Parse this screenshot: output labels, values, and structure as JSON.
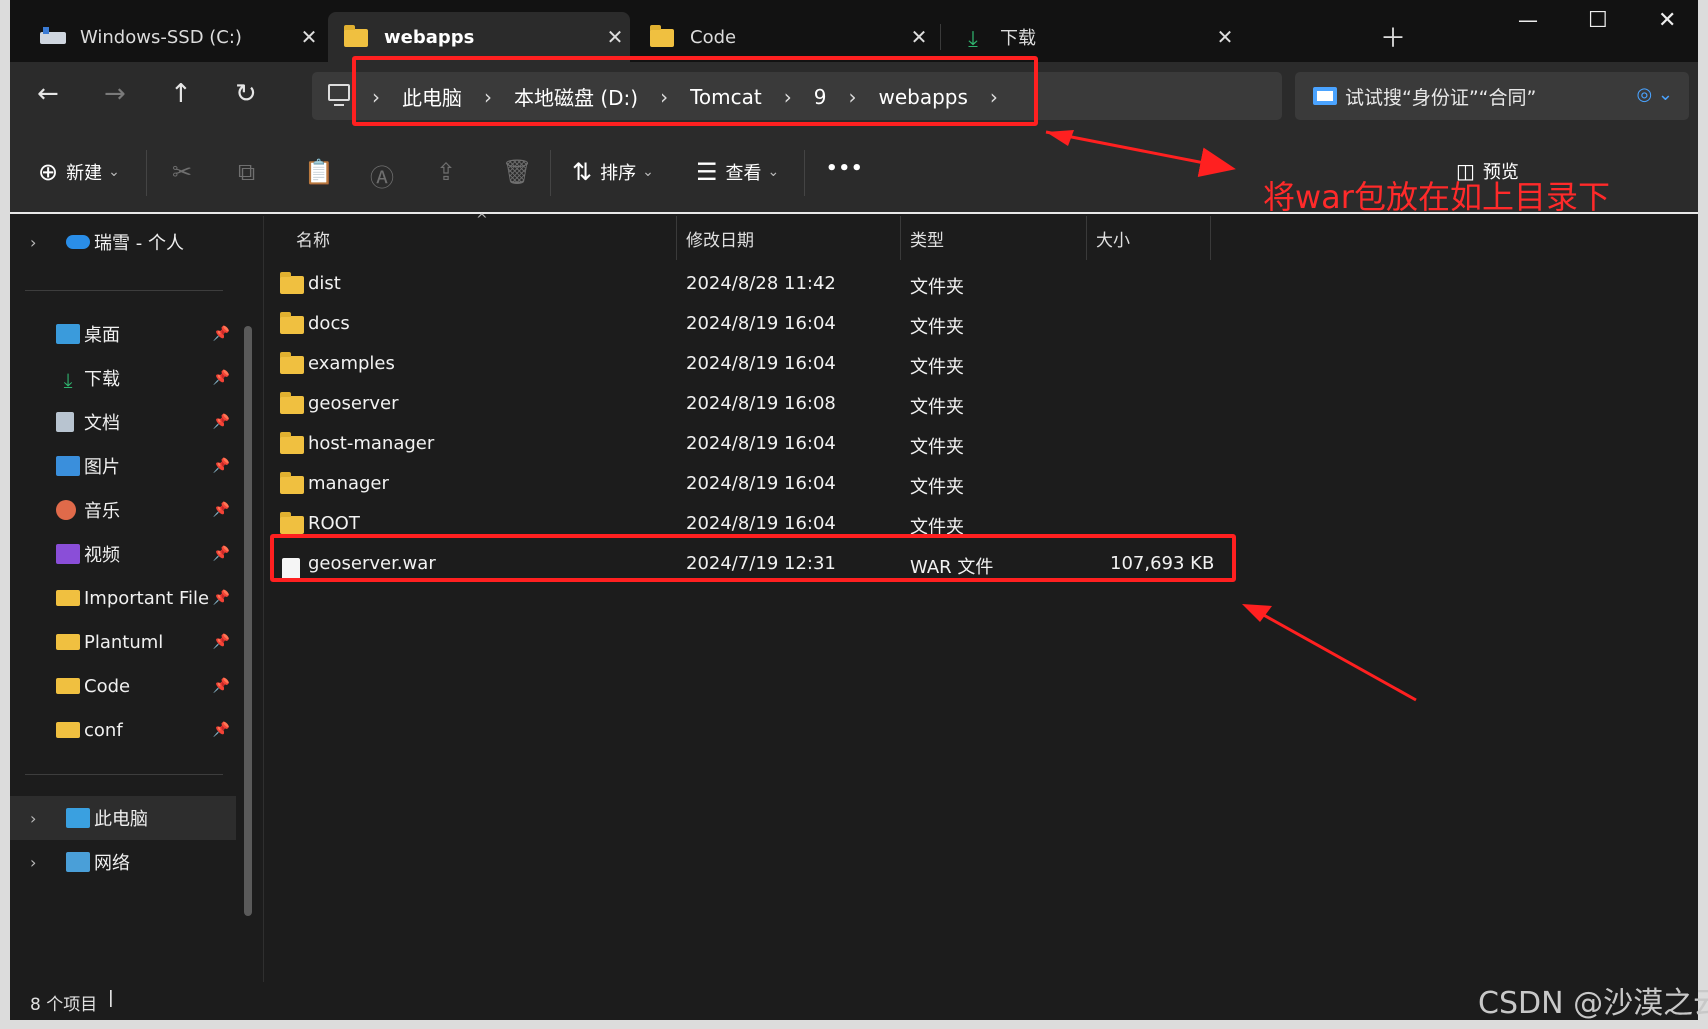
{
  "tabs": [
    {
      "label": "Windows-SSD (C:)",
      "icon": "drive-icon"
    },
    {
      "label": "webapps",
      "icon": "folder-icon"
    },
    {
      "label": "Code",
      "icon": "folder-icon"
    },
    {
      "label": "下载",
      "icon": "download-icon"
    }
  ],
  "address": {
    "crumbs": [
      "此电脑",
      "本地磁盘 (D:)",
      "Tomcat",
      "9",
      "webapps"
    ]
  },
  "search": {
    "placeholder": "试试搜“身份证”“合同”"
  },
  "commands": {
    "new": "新建",
    "sort": "排序",
    "view": "查看",
    "more": "•••",
    "preview": "预览"
  },
  "sidebar": {
    "top": "瑞雪 - 个人",
    "items": [
      {
        "label": "桌面",
        "color": "#3a9bdc"
      },
      {
        "label": "下载",
        "color": "#2fb36e"
      },
      {
        "label": "文档",
        "color": "#b8c4d0"
      },
      {
        "label": "图片",
        "color": "#3a8fdc"
      },
      {
        "label": "音乐",
        "color": "#e06a4a"
      },
      {
        "label": "视频",
        "color": "#8a4ed8"
      },
      {
        "label": "Important File",
        "color": "#f0c040"
      },
      {
        "label": "Plantuml",
        "color": "#f0c040"
      },
      {
        "label": "Code",
        "color": "#f0c040"
      },
      {
        "label": "conf",
        "color": "#f0c040"
      }
    ],
    "this_pc": "此电脑",
    "network": "网络"
  },
  "columns": {
    "name": "名称",
    "modified": "修改日期",
    "type": "类型",
    "size": "大小"
  },
  "files": [
    {
      "name": "dist",
      "modified": "2024/8/28 11:42",
      "type": "文件夹",
      "size": "",
      "kind": "folder"
    },
    {
      "name": "docs",
      "modified": "2024/8/19 16:04",
      "type": "文件夹",
      "size": "",
      "kind": "folder"
    },
    {
      "name": "examples",
      "modified": "2024/8/19 16:04",
      "type": "文件夹",
      "size": "",
      "kind": "folder"
    },
    {
      "name": "geoserver",
      "modified": "2024/8/19 16:08",
      "type": "文件夹",
      "size": "",
      "kind": "folder"
    },
    {
      "name": "host-manager",
      "modified": "2024/8/19 16:04",
      "type": "文件夹",
      "size": "",
      "kind": "folder"
    },
    {
      "name": "manager",
      "modified": "2024/8/19 16:04",
      "type": "文件夹",
      "size": "",
      "kind": "folder"
    },
    {
      "name": "ROOT",
      "modified": "2024/8/19 16:04",
      "type": "文件夹",
      "size": "",
      "kind": "folder"
    },
    {
      "name": "geoserver.war",
      "modified": "2024/7/19 12:31",
      "type": "WAR 文件",
      "size": "107,693 KB",
      "kind": "file"
    }
  ],
  "annotation": "将war包放在如上目录下",
  "status": "8 个项目",
  "watermark": "CSDN @沙漠之云"
}
